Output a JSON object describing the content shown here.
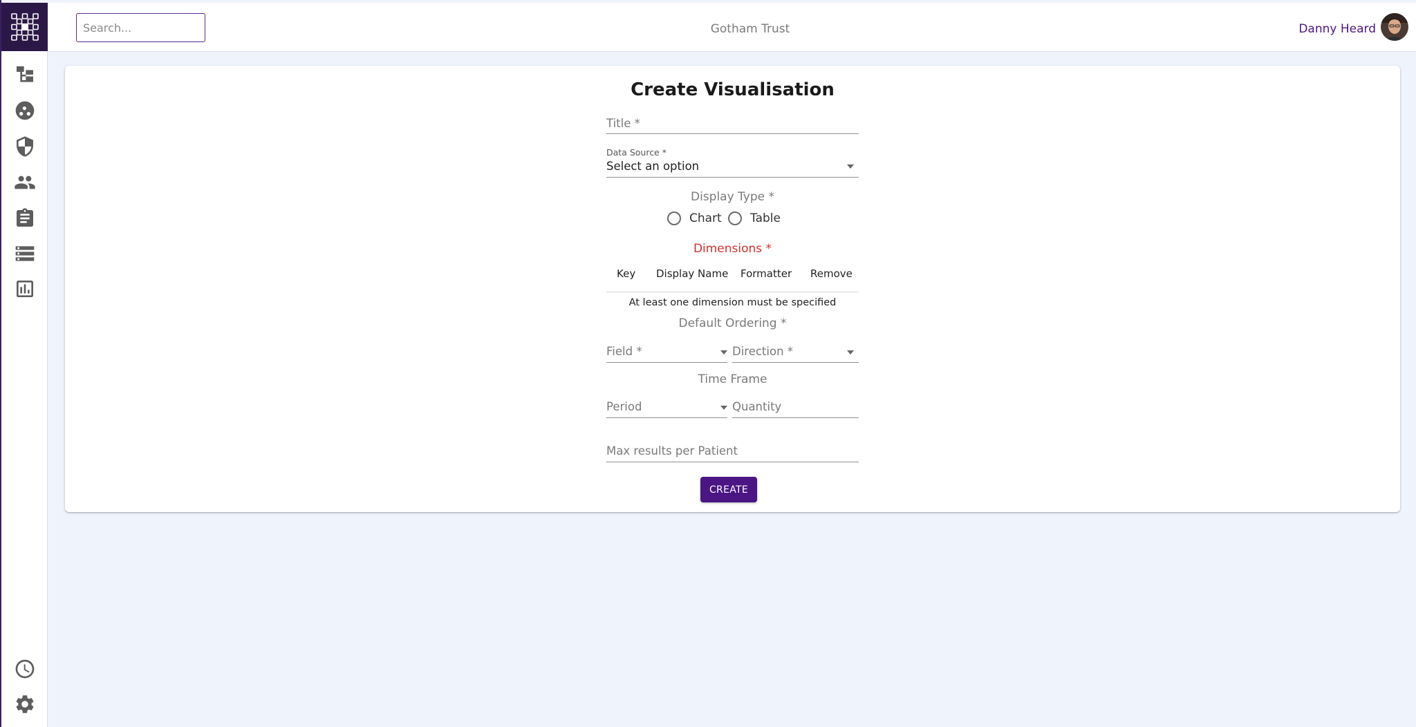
{
  "header": {
    "search_placeholder": "Search...",
    "org_name": "Gotham Trust",
    "user_name": "Danny Heard"
  },
  "sidebar": {
    "items": [
      {
        "icon": "hierarchy-icon"
      },
      {
        "icon": "groups-circle-icon"
      },
      {
        "icon": "shield-icon"
      },
      {
        "icon": "people-icon"
      },
      {
        "icon": "clipboard-icon"
      },
      {
        "icon": "list-icon"
      },
      {
        "icon": "bar-chart-icon"
      }
    ],
    "bottom_items": [
      {
        "icon": "clock-icon"
      },
      {
        "icon": "gear-icon"
      }
    ]
  },
  "form": {
    "title": "Create Visualisation",
    "title_field_label": "Title *",
    "data_source_label": "Data Source *",
    "data_source_value": "Select an option",
    "display_type_label": "Display Type *",
    "display_type_options": [
      "Chart",
      "Table"
    ],
    "dimensions_label": "Dimensions *",
    "dimension_columns": [
      "Key",
      "Display Name",
      "Formatter",
      "Remove"
    ],
    "dimensions_empty": "At least one dimension must be specified",
    "default_ordering_label": "Default Ordering *",
    "field_label": "Field *",
    "direction_label": "Direction *",
    "time_frame_label": "Time Frame",
    "period_label": "Period",
    "quantity_label": "Quantity",
    "max_results_label": "Max results per Patient",
    "create_label": "CREATE"
  },
  "colors": {
    "brand": "#4b1584",
    "sidebar_logo_bg": "#2c1846",
    "error": "#d32f2f",
    "page_bg": "#eff4fc"
  }
}
